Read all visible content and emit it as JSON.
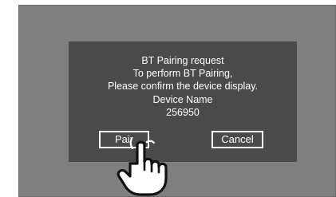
{
  "dialog": {
    "lines": [
      "BT Pairing request",
      "To perform BT Pairing,",
      "Please confirm the device display.",
      "Device Name",
      "256950"
    ],
    "pair_label": "Pair",
    "cancel_label": "Cancel"
  },
  "icons": {
    "pointer": "pointing-hand-icon"
  },
  "colors": {
    "screen_background": "#7f7f7f",
    "dialog_background": "#4a4a4a",
    "text": "#ffffff"
  }
}
